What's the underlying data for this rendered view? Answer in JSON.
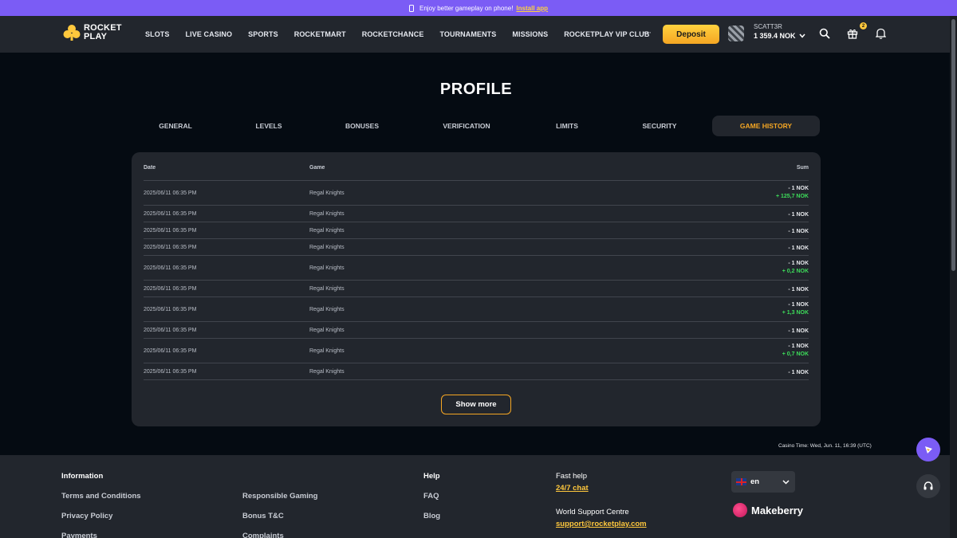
{
  "promo": {
    "text": "Enjoy better gameplay on phone!",
    "link": "Install app"
  },
  "logo": {
    "line1": "ROCKET",
    "line2": "PLAY"
  },
  "nav": [
    "SLOTS",
    "LIVE CASINO",
    "SPORTS",
    "ROCKETMART",
    "ROCKETCHANCE",
    "TOURNAMENTS",
    "MISSIONS",
    "ROCKETPLAY VIP CLUB"
  ],
  "nav_more": "···",
  "deposit_label": "Deposit",
  "user": {
    "name": "SCATT3R",
    "balance": "1 359.4 NOK"
  },
  "gift_count": "2",
  "page_title": "PROFILE",
  "tabs": [
    {
      "label": "GENERAL",
      "active": false
    },
    {
      "label": "LEVELS",
      "active": false
    },
    {
      "label": "BONUSES",
      "active": false
    },
    {
      "label": "VERIFICATION",
      "active": false
    },
    {
      "label": "LIMITS",
      "active": false
    },
    {
      "label": "SECURITY",
      "active": false
    },
    {
      "label": "GAME HISTORY",
      "active": true
    }
  ],
  "table": {
    "headers": {
      "date": "Date",
      "game": "Game",
      "sum": "Sum"
    },
    "rows": [
      {
        "date": "2025/06/11 06:35 PM",
        "game": "Regal Knights",
        "bet": "- 1 NOK",
        "win": "+ 125,7 NOK"
      },
      {
        "date": "2025/06/11 06:35 PM",
        "game": "Regal Knights",
        "bet": "- 1 NOK",
        "win": ""
      },
      {
        "date": "2025/06/11 06:35 PM",
        "game": "Regal Knights",
        "bet": "- 1 NOK",
        "win": ""
      },
      {
        "date": "2025/06/11 06:35 PM",
        "game": "Regal Knights",
        "bet": "- 1 NOK",
        "win": ""
      },
      {
        "date": "2025/06/11 06:35 PM",
        "game": "Regal Knights",
        "bet": "- 1 NOK",
        "win": "+ 0,2 NOK"
      },
      {
        "date": "2025/06/11 06:35 PM",
        "game": "Regal Knights",
        "bet": "- 1 NOK",
        "win": ""
      },
      {
        "date": "2025/06/11 06:35 PM",
        "game": "Regal Knights",
        "bet": "- 1 NOK",
        "win": "+ 1,3 NOK"
      },
      {
        "date": "2025/06/11 06:35 PM",
        "game": "Regal Knights",
        "bet": "- 1 NOK",
        "win": ""
      },
      {
        "date": "2025/06/11 06:35 PM",
        "game": "Regal Knights",
        "bet": "- 1 NOK",
        "win": "+ 0,7 NOK"
      },
      {
        "date": "2025/06/11 06:35 PM",
        "game": "Regal Knights",
        "bet": "- 1 NOK",
        "win": ""
      }
    ]
  },
  "show_more_label": "Show more",
  "casino_time": "Casino Time: Wed, Jun. 11, 16:39 (UTC)",
  "footer": {
    "information_title": "Information",
    "col1": [
      "Terms and Conditions",
      "Privacy Policy",
      "Payments"
    ],
    "col2": [
      "Responsible Gaming",
      "Bonus T&C",
      "Complaints"
    ],
    "help_title": "Help",
    "help_links": [
      "FAQ",
      "Blog"
    ],
    "fast_help": "Fast help",
    "chat_link": "24/7 chat",
    "support_centre": "World Support Centre",
    "support_email": "support@rocketplay.com",
    "language": "en",
    "provider": "Makeberry"
  },
  "colors": {
    "accent": "#f5a623",
    "promo_bar": "#7b5cf5",
    "win": "#3ddc5a",
    "card": "#22262d"
  }
}
